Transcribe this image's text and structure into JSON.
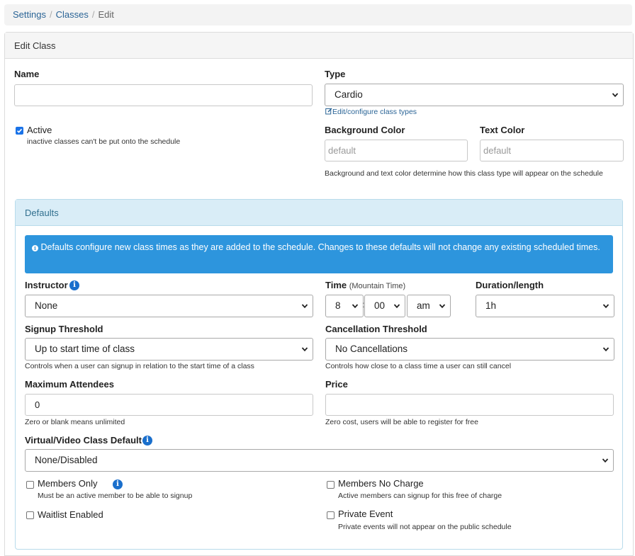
{
  "breadcrumb": {
    "items": [
      "Settings",
      "Classes"
    ],
    "current": "Edit",
    "separator": "/"
  },
  "panel": {
    "title": "Edit Class"
  },
  "form": {
    "name_label": "Name",
    "name_value": "",
    "type_label": "Type",
    "type_value": "Cardio",
    "edit_types_link": "Edit/configure class types",
    "active_label": "Active",
    "active_checked": true,
    "active_help": "inactive classes can't be put onto the schedule",
    "bg_color_label": "Background Color",
    "bg_color_placeholder": "default",
    "text_color_label": "Text Color",
    "text_color_placeholder": "default",
    "color_help": "Background and text color determine how this class type will appear on the schedule"
  },
  "defaults": {
    "title": "Defaults",
    "alert": "Defaults configure new class times as they are added to the schedule. Changes to these defaults will not change any existing scheduled times.",
    "instructor_label": "Instructor",
    "instructor_value": "None",
    "time_label": "Time",
    "time_zone": "(Mountain Time)",
    "time_hour": "8",
    "time_minute": "00",
    "time_ampm": "am",
    "duration_label": "Duration/length",
    "duration_value": "1h",
    "signup_label": "Signup Threshold",
    "signup_value": "Up to start time of class",
    "signup_help": "Controls when a user can signup in relation to the start time of a class",
    "cancel_label": "Cancellation Threshold",
    "cancel_value": "No Cancellations",
    "cancel_help": "Controls how close to a class time a user can still cancel",
    "max_label": "Maximum Attendees",
    "max_value": "0",
    "max_help": "Zero or blank means unlimited",
    "price_label": "Price",
    "price_value": "",
    "price_help": "Zero cost, users will be able to register for free",
    "virtual_label": "Virtual/Video Class Default",
    "virtual_value": "None/Disabled",
    "members_only_label": "Members Only",
    "members_only_help": "Must be an active member to be able to signup",
    "members_no_charge_label": "Members No Charge",
    "members_no_charge_help": "Active members can signup for this free of charge",
    "waitlist_label": "Waitlist Enabled",
    "private_label": "Private Event",
    "private_help": "Private events will not appear on the public schedule"
  },
  "colors": {
    "link": "#2a6496",
    "checkbox_on": "#1a73e8",
    "alert_bg": "#2d95dd",
    "defaults_heading_bg": "#d9edf7",
    "info_icon": "#1a6fcc"
  }
}
